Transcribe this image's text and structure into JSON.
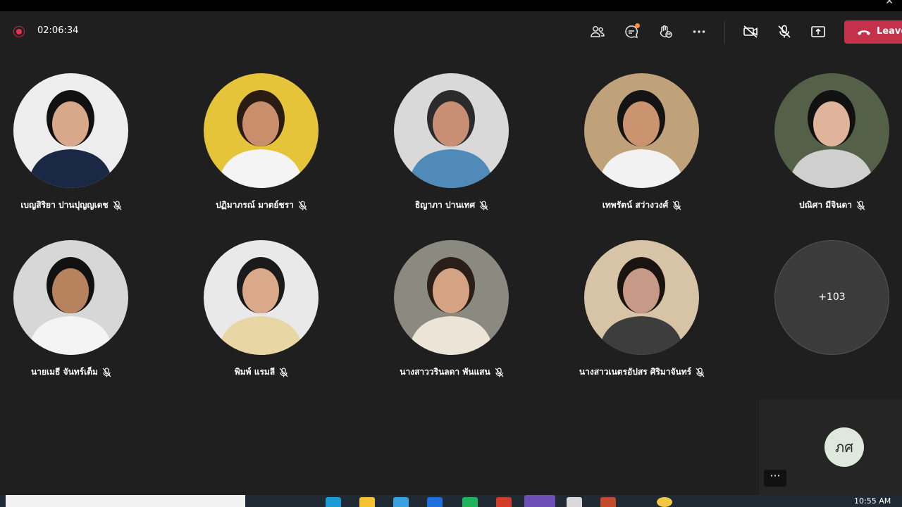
{
  "meeting": {
    "elapsed": "02:06:34",
    "leave_label": "Leave"
  },
  "participants": [
    {
      "name": "เบญสิริยา ปานปุญญเดช",
      "skin": "#d8a88a",
      "bg": "#eeeeee",
      "shirt": "#1b2845",
      "hair": "#111111"
    },
    {
      "name": "ปฏิมาภรณ์ มาตย์ชรา",
      "skin": "#c98f6c",
      "bg": "#e6c43a",
      "shirt": "#f4f4f4",
      "hair": "#2a1c12"
    },
    {
      "name": "ธิญาภา ปานเทศ",
      "skin": "#c98f75",
      "bg": "#d9d9d9",
      "shirt": "#4f8ab8",
      "hair": "#2b2b2b"
    },
    {
      "name": "เทพรัตน์ สว่างวงศ์",
      "skin": "#c9946f",
      "bg": "#c0a27a",
      "shirt": "#f2f2f2",
      "hair": "#141414"
    },
    {
      "name": "ปณิศา มีจินดา",
      "skin": "#e0b49a",
      "bg": "#556048",
      "shirt": "#cfcfcf",
      "hair": "#111111"
    },
    {
      "name": "นายเมธี จันทร์เต็ม",
      "skin": "#b7835f",
      "bg": "#d7d7d7",
      "shirt": "#f4f4f4",
      "hair": "#111111"
    },
    {
      "name": "พิมพ์ แรมลี",
      "skin": "#d9a98a",
      "bg": "#e9e9e9",
      "shirt": "#e8d7a4",
      "hair": "#1a1a1a"
    },
    {
      "name": "นางสาววรินลดา พันแสน",
      "skin": "#d3a383",
      "bg": "#8a8a80",
      "shirt": "#ece4d6",
      "hair": "#2a1e16"
    },
    {
      "name": "นางสาวเนตรอัปสร ศิริมาจันทร์",
      "skin": "#c69a86",
      "bg": "#d7c4a6",
      "shirt": "#3d3d3d",
      "hair": "#1a1410"
    }
  ],
  "overflow": {
    "label": "+103"
  },
  "self": {
    "initials": "ภศ",
    "more_label": "···"
  },
  "taskbar": {
    "time": "10:55 AM"
  },
  "colors": {
    "accent": "#c4314b",
    "recording": "#e8334d"
  }
}
